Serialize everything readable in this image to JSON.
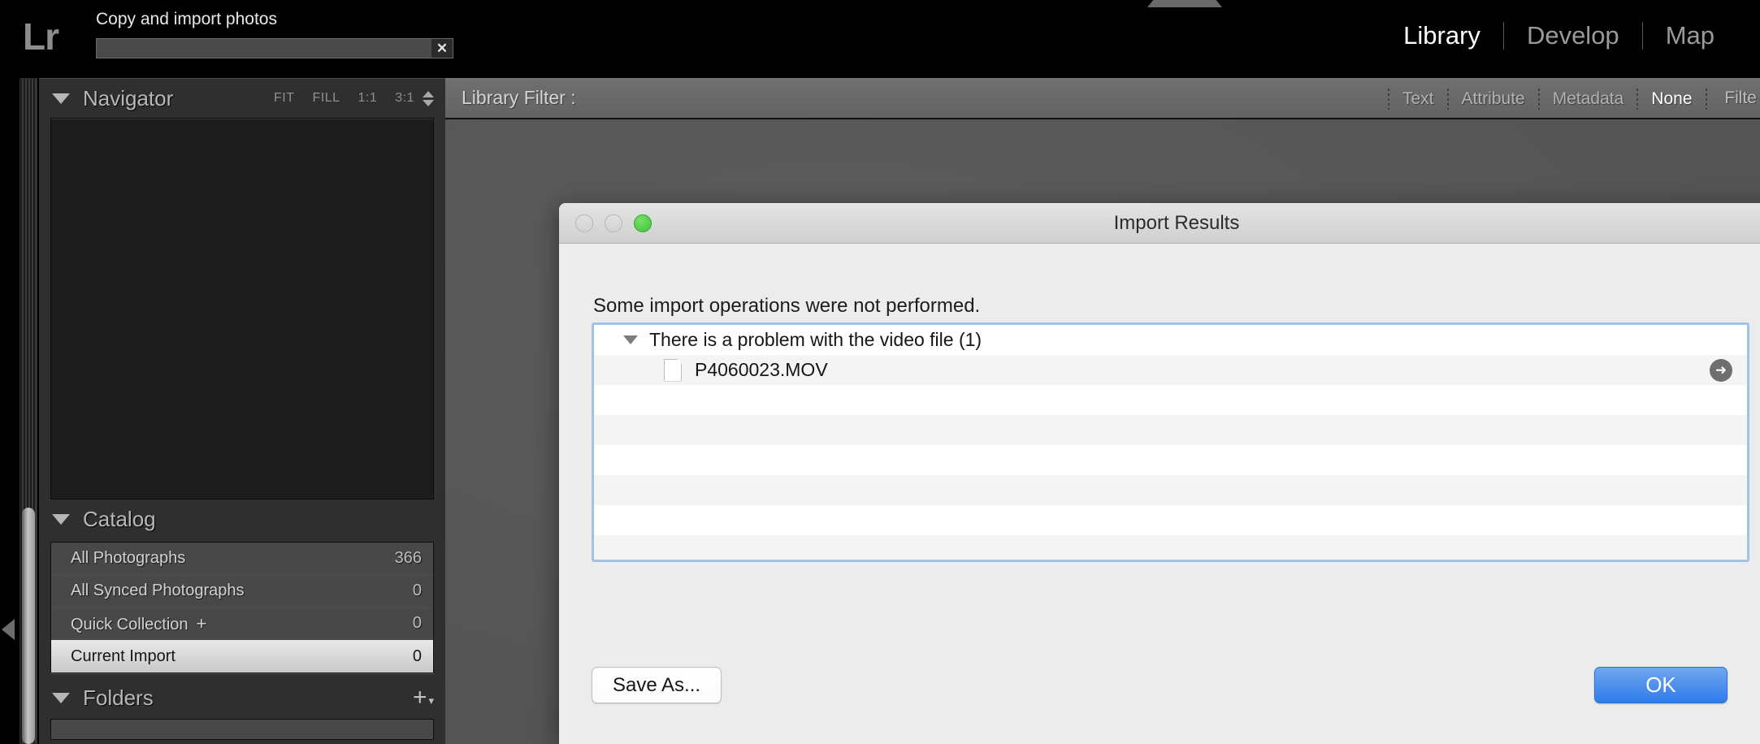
{
  "app": {
    "logo": "Lr",
    "import_title": "Copy and import photos",
    "close_icon": "✕"
  },
  "modules": [
    {
      "label": "Library",
      "active": true
    },
    {
      "label": "Develop",
      "active": false
    },
    {
      "label": "Map",
      "active": false
    }
  ],
  "navigator": {
    "title": "Navigator",
    "zoom_levels": [
      "FIT",
      "FILL",
      "1:1",
      "3:1"
    ]
  },
  "catalog": {
    "title": "Catalog",
    "rows": [
      {
        "name": "All Photographs",
        "count": "366",
        "selected": false,
        "plus": ""
      },
      {
        "name": "All Synced Photographs",
        "count": "0",
        "selected": false,
        "plus": ""
      },
      {
        "name": "Quick Collection",
        "count": "0",
        "selected": false,
        "plus": "+"
      },
      {
        "name": "Current Import",
        "count": "0",
        "selected": true,
        "plus": ""
      }
    ]
  },
  "folders": {
    "title": "Folders",
    "add_icon": "+",
    "caret": "▾"
  },
  "library_filter": {
    "label": "Library Filter :",
    "options": [
      {
        "label": "Text",
        "active": false
      },
      {
        "label": "Attribute",
        "active": false
      },
      {
        "label": "Metadata",
        "active": false
      },
      {
        "label": "None",
        "active": true
      }
    ],
    "right_label": "Filte"
  },
  "dialog": {
    "title": "Import Results",
    "message": "Some import operations were not performed.",
    "groups": [
      {
        "label": "There is a problem with the video file (1)",
        "expanded": true,
        "files": [
          {
            "name": "P4060023.MOV",
            "action_icon": "➜"
          }
        ]
      }
    ],
    "empty_row_count": 6,
    "save_as_label": "Save As...",
    "ok_label": "OK",
    "accent_color": "#2e7ceb",
    "focus_ring_color": "#a3c2e8"
  }
}
